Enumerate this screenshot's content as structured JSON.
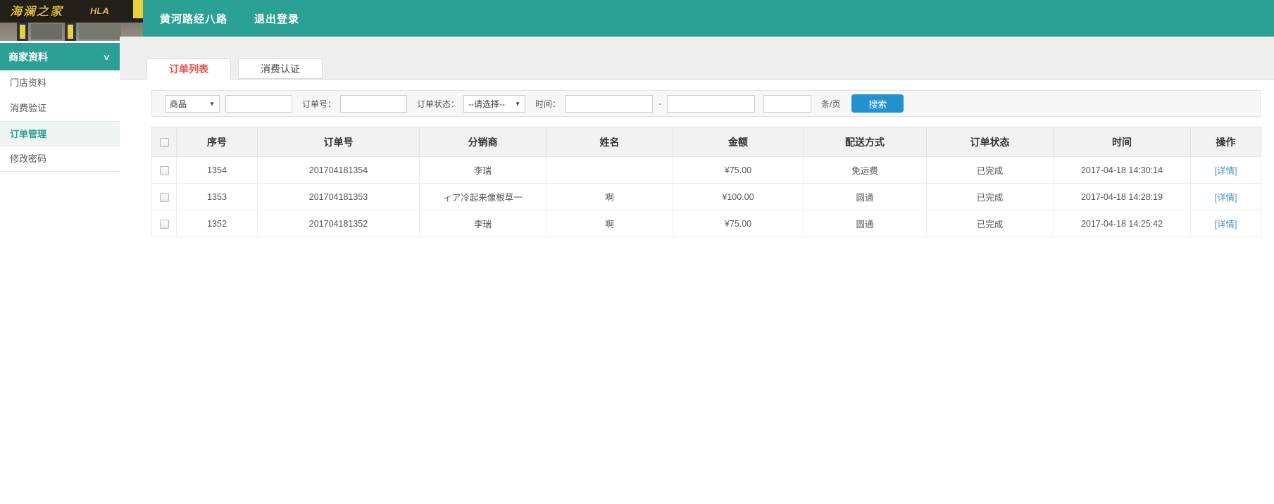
{
  "topbar": {
    "store_name": "黄河路经八路",
    "logout_label": "退出登录"
  },
  "photo": {
    "brand_text": "海澜之家",
    "brand_letters": "HLA"
  },
  "sidebar": {
    "header_label": "商家资料",
    "items": [
      {
        "label": "门店资料",
        "active": false
      },
      {
        "label": "消费验证",
        "active": false
      },
      {
        "label": "订单管理",
        "active": true
      },
      {
        "label": "修改密码",
        "active": false
      }
    ]
  },
  "tabs": [
    {
      "label": "订单列表",
      "active": true
    },
    {
      "label": "消费认证",
      "active": false
    }
  ],
  "filters": {
    "product_select_value": "商品",
    "order_no_label": "订单号：",
    "order_status_label": "订单状态：",
    "status_select_value": "--请选择--",
    "time_label": "时间：",
    "range_separator": "-",
    "per_page_label": "条/页",
    "search_button": "搜索"
  },
  "table": {
    "columns": [
      "序号",
      "订单号",
      "分销商",
      "姓名",
      "金额",
      "配送方式",
      "订单状态",
      "时间",
      "操作"
    ],
    "rows": [
      {
        "seq": "1354",
        "order_no": "201704181354",
        "distributor": "李瑞",
        "name": "",
        "amount": "¥75.00",
        "shipping": "免运费",
        "status": "已完成",
        "time": "2017-04-18 14:30:14",
        "action": "[详情]"
      },
      {
        "seq": "1353",
        "order_no": "201704181353",
        "distributor": "ィア冷起来像根草一",
        "name": "啊",
        "amount": "¥100.00",
        "shipping": "圆通",
        "status": "已完成",
        "time": "2017-04-18 14:28:19",
        "action": "[详情]"
      },
      {
        "seq": "1352",
        "order_no": "201704181352",
        "distributor": "李瑞",
        "name": "啊",
        "amount": "¥75.00",
        "shipping": "圆通",
        "status": "已完成",
        "time": "2017-04-18 14:25:42",
        "action": "[详情]"
      }
    ]
  },
  "colors": {
    "topbar_teal": "#2ba094",
    "active_tab_red": "#e8514b",
    "search_button_blue": "#2191d0",
    "detail_link_blue": "#4a90c4",
    "table_header_gray": "#f2f2f2",
    "strip_gray": "#efefef"
  }
}
